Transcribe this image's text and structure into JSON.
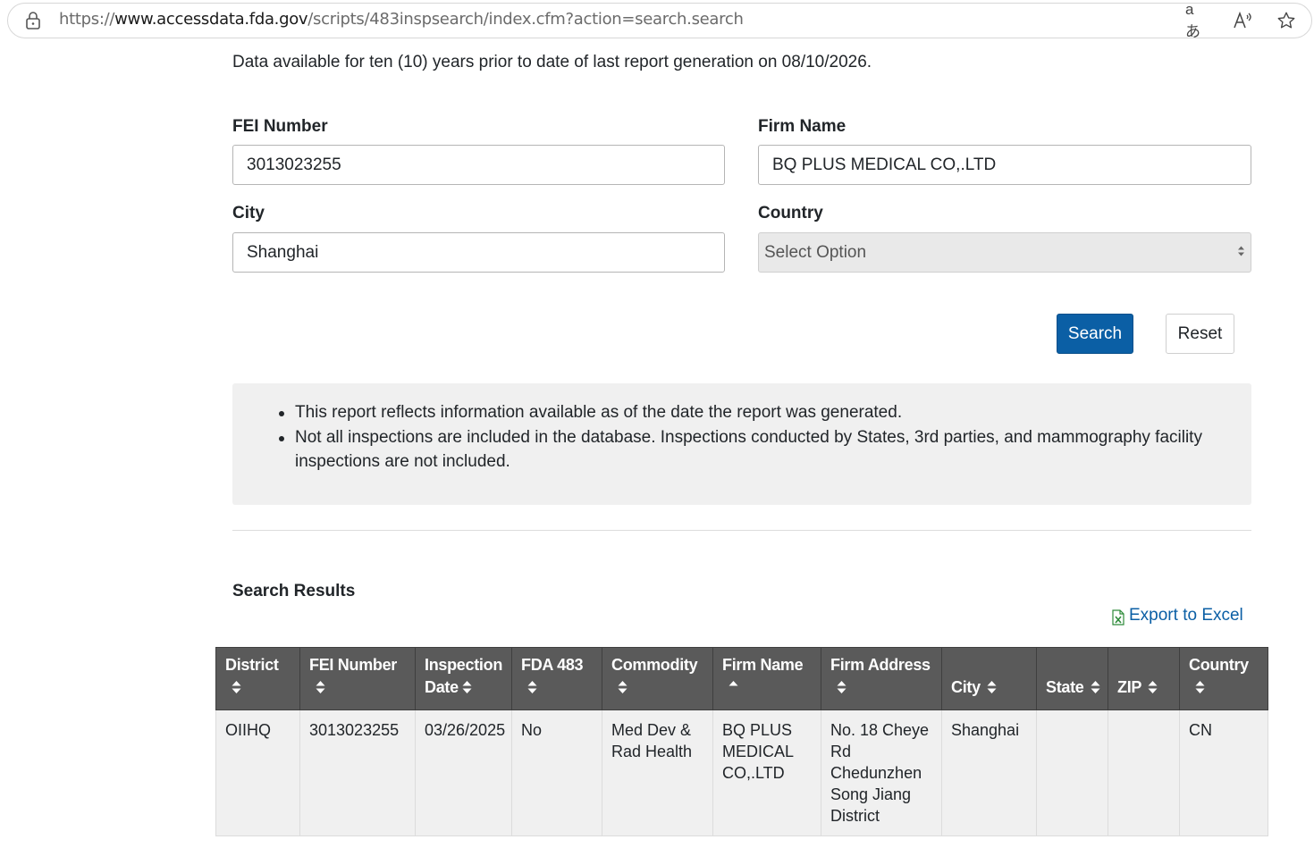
{
  "browser": {
    "url_prefix": "https://",
    "url_host": "www.accessdata.fda.gov",
    "url_path": "/scripts/483inspsearch/index.cfm?action=search.search",
    "translate_icon": "aあ",
    "read_aloud_icon": "A⁾"
  },
  "page": {
    "notice": "Data available for ten (10) years prior to date of last report generation on 08/10/2026."
  },
  "form": {
    "fei_label": "FEI Number",
    "fei_value": "3013023255",
    "firm_label": "Firm Name",
    "firm_value": "BQ PLUS MEDICAL CO,.LTD",
    "city_label": "City",
    "city_value": "Shanghai",
    "country_label": "Country",
    "country_value": "Select Option",
    "search_label": "Search",
    "reset_label": "Reset"
  },
  "info": {
    "items": [
      "This report reflects information available as of the date the report was generated.",
      "Not all inspections are included in the database. Inspections conducted by States, 3rd parties, and mammography facility inspections are not included."
    ]
  },
  "results": {
    "title": "Search Results",
    "export_label": "Export to Excel",
    "columns": [
      "District",
      "FEI Number",
      "Inspection Date",
      "FDA 483",
      "Commodity",
      "Firm Name",
      "Firm Address",
      "City",
      "State",
      "ZIP",
      "Country"
    ],
    "rows": [
      {
        "district": "OIIHQ",
        "fei": "3013023255",
        "date": "03/26/2025",
        "fda483": "No",
        "commodity": "Med Dev & Rad Health",
        "firm": "BQ PLUS MEDICAL CO,.LTD",
        "address": "No. 18 Cheye Rd Chedunzhen Song Jiang District",
        "city": "Shanghai",
        "state": "",
        "zip": "",
        "country": "CN"
      }
    ]
  },
  "colors": {
    "primary": "#0b5fa5",
    "table_header": "#5a5a5a",
    "panel": "#f0f0f0"
  },
  "icons": {
    "lock": "lock-icon",
    "translate": "translate-icon",
    "read_aloud": "read-aloud-icon",
    "favorite": "star-icon",
    "excel": "excel-icon",
    "sort": "sort-icon",
    "sort_asc": "sort-asc-icon"
  }
}
